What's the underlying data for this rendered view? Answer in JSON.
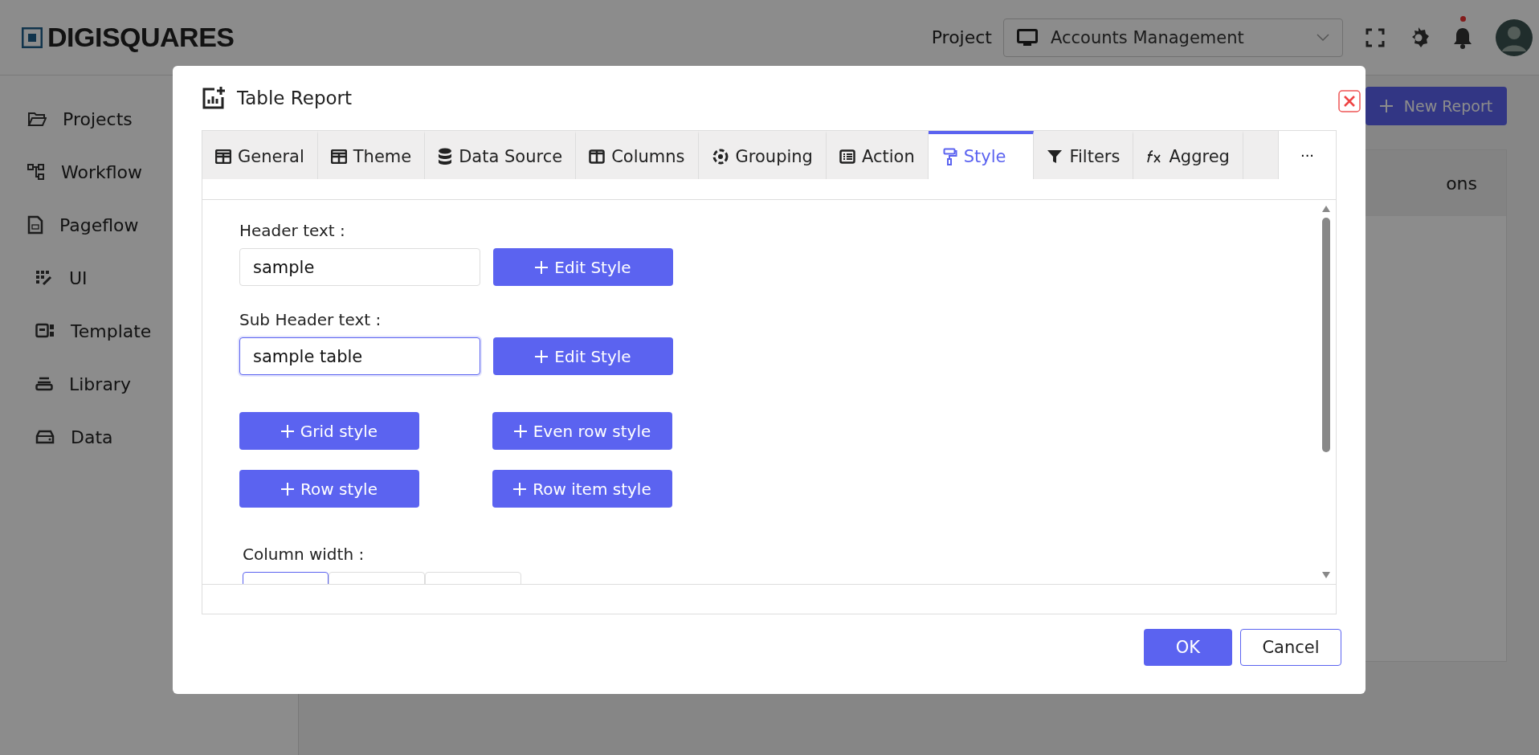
{
  "header": {
    "logo": "DIGISQUARES",
    "project_label": "Project",
    "project": "Accounts Management",
    "notification_dot": true
  },
  "sidebar": {
    "items": [
      {
        "label": "Projects",
        "kind": "folder",
        "indent": false
      },
      {
        "label": "Workflow",
        "kind": "workflow",
        "indent": false
      },
      {
        "label": "Pageflow",
        "kind": "page",
        "indent": false
      },
      {
        "label": "UI",
        "kind": "ui",
        "indent": true
      },
      {
        "label": "Template",
        "kind": "template",
        "indent": true
      },
      {
        "label": "Library",
        "kind": "library",
        "indent": true
      },
      {
        "label": "Data",
        "kind": "data",
        "indent": true
      }
    ]
  },
  "page": {
    "new_report_button": "New Report",
    "table_header": "ons"
  },
  "dialog": {
    "title": "Table Report",
    "tabs": [
      {
        "label": "General",
        "kind": "table",
        "selected": false
      },
      {
        "label": "Theme",
        "kind": "table",
        "selected": false
      },
      {
        "label": "Data Source",
        "kind": "database",
        "selected": false
      },
      {
        "label": "Columns",
        "kind": "columns",
        "selected": false
      },
      {
        "label": "Grouping",
        "kind": "grouping",
        "selected": false
      },
      {
        "label": "Action",
        "kind": "list",
        "selected": false
      },
      {
        "label": "Style",
        "kind": "brush",
        "selected": true
      },
      {
        "label": "Filters",
        "kind": "filter",
        "selected": false
      },
      {
        "label": "Aggreg",
        "kind": "fx",
        "selected": false
      }
    ],
    "more": "···",
    "fields": [
      {
        "label": "Header text :",
        "value": "sample",
        "focused": false,
        "button": "Edit Style"
      },
      {
        "label": "Sub Header text :",
        "value": "sample table",
        "focused": true,
        "button": "Edit Style"
      }
    ],
    "style_buttons": [
      "Grid style",
      "Even row style",
      "Row style",
      "Row item style"
    ],
    "column_width_label": "Column width :",
    "column_width_segments": [
      {
        "selected": true
      },
      {
        "selected": false
      },
      {
        "selected": false
      }
    ],
    "ok": "OK",
    "cancel": "Cancel"
  }
}
